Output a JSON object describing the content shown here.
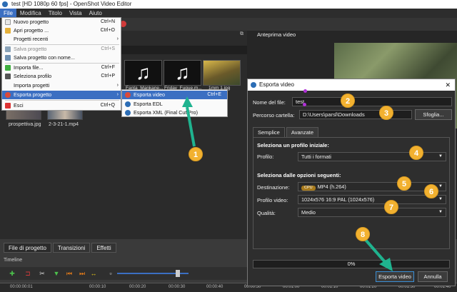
{
  "window": {
    "title": "test [HD 1080p 60 fps] - OpenShot Video Editor"
  },
  "menubar": [
    "File",
    "Modifica",
    "Titolo",
    "Vista",
    "Aiuto"
  ],
  "file_menu": {
    "items": [
      {
        "label": "Nuovo progetto",
        "shortcut": "Ctrl+N",
        "icon": "new-project-icon"
      },
      {
        "label": "Apri progetto ...",
        "shortcut": "Ctrl+O",
        "icon": "open-project-icon"
      },
      {
        "label": "Progetti recenti",
        "shortcut": "",
        "icon": ""
      },
      {
        "label": "Salva progetto",
        "shortcut": "Ctrl+S",
        "icon": "save-icon"
      },
      {
        "label": "Salva progetto con nome...",
        "shortcut": "",
        "icon": "save-as-icon"
      },
      {
        "label": "Importa file...",
        "shortcut": "Ctrl+F",
        "icon": "import-icon"
      },
      {
        "label": "Seleziona profilo",
        "shortcut": "Ctrl+P",
        "icon": "profile-icon"
      },
      {
        "label": "Importa progetti",
        "shortcut": "",
        "icon": ""
      },
      {
        "label": "Esporta progetto",
        "shortcut": "",
        "icon": "export-icon"
      },
      {
        "label": "Esci",
        "shortcut": "Ctrl+Q",
        "icon": "exit-icon"
      }
    ]
  },
  "export_submenu": {
    "items": [
      {
        "label": "Esporta video",
        "shortcut": "Ctrl+E"
      },
      {
        "label": "Esporta EDL",
        "shortcut": ""
      },
      {
        "label": "Esporta XML (Final Cut Pro)",
        "shortcut": ""
      }
    ]
  },
  "project_files": {
    "search_placeholder": "ro",
    "thumbs": [
      {
        "label": "Fanta_Mankane..."
      },
      {
        "label": "Friday_Fugue.m..."
      },
      {
        "label": "1mm 1.jpg"
      }
    ],
    "lower_files": [
      "prospettiva.jpg",
      "2-3-21-1.mp4"
    ]
  },
  "preview": {
    "title": "Anteprima video"
  },
  "bottom_tabs": [
    "File di progetto",
    "Transizioni",
    "Effetti"
  ],
  "timeline": {
    "label": "Timeline",
    "ruler": [
      "00:00:00:01",
      "00:00:10",
      "00:00:20",
      "00:00:30",
      "00:00:40",
      "00:00:50",
      "00:01:00",
      "00:01:10",
      "00:01:20",
      "00:01:30",
      "00:01:40"
    ]
  },
  "dialog": {
    "title": "Esporta video",
    "filename_label": "Nome del file:",
    "filename_value": "test",
    "folder_label": "Percorso cartella:",
    "folder_value": "D:\\Users\\parsl\\Downloads",
    "browse_button": "Sfoglia...",
    "tabs": [
      "Semplice",
      "Avanzate"
    ],
    "section_profile": "Seleziona un profilo iniziale:",
    "profile_label": "Profilo:",
    "profile_value": "Tutti i formati",
    "section_options": "Seleziona dalle opzioni seguenti:",
    "destination_label": "Destinazione:",
    "destination_badge": "CPU",
    "destination_value": "MP4 (h.264)",
    "video_profile_label": "Profilo video:",
    "video_profile_value": "1024x576 16:9 PAL (1024x576)",
    "quality_label": "Qualità:",
    "quality_value": "Medio",
    "progress_text": "0%",
    "export_button": "Esporta video",
    "cancel_button": "Annulla"
  },
  "annotations": [
    "1",
    "2",
    "3",
    "4",
    "5",
    "6",
    "7",
    "8"
  ],
  "colors": {
    "accent": "#3b6fc2",
    "badge": "#f2b130",
    "arrow": "#1fb38f",
    "marker": "#b02fd6"
  }
}
